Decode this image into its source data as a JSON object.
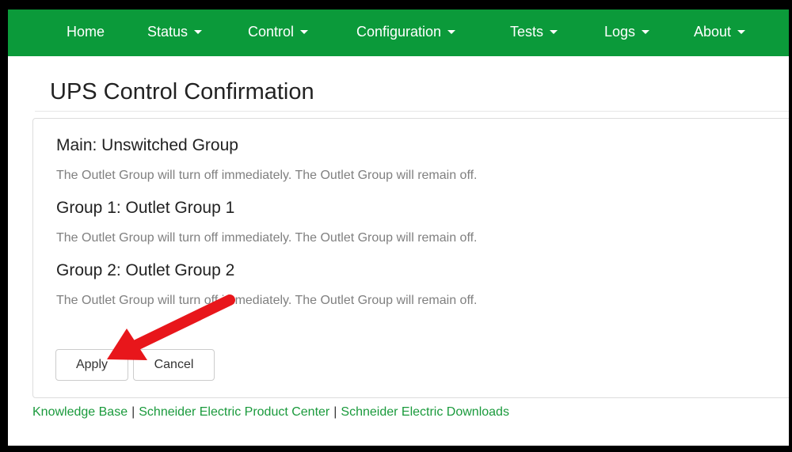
{
  "nav": {
    "items": [
      {
        "label": "Home",
        "dropdown": false
      },
      {
        "label": "Status",
        "dropdown": true
      },
      {
        "label": "Control",
        "dropdown": true
      },
      {
        "label": "Configuration",
        "dropdown": true
      },
      {
        "label": "Tests",
        "dropdown": true
      },
      {
        "label": "Logs",
        "dropdown": true
      },
      {
        "label": "About",
        "dropdown": true
      }
    ]
  },
  "page": {
    "title": "UPS Control Confirmation"
  },
  "groups": [
    {
      "title": "Main: Unswitched Group",
      "description": "The Outlet Group will turn off immediately. The Outlet Group will remain off."
    },
    {
      "title": "Group 1: Outlet Group 1",
      "description": "The Outlet Group will turn off immediately. The Outlet Group will remain off."
    },
    {
      "title": "Group 2: Outlet Group 2",
      "description": "The Outlet Group will turn off immediately. The Outlet Group will remain off."
    }
  ],
  "actions": {
    "apply_label": "Apply",
    "cancel_label": "Cancel"
  },
  "footer": {
    "links": [
      "Knowledge Base",
      "Schneider Electric Product Center",
      "Schneider Electric Downloads"
    ],
    "separator": "|"
  },
  "colors": {
    "navbar": "#0b9a3a",
    "link": "#1a9a3c",
    "annotation_arrow": "#e8161b"
  },
  "annotation": {
    "icon": "red-arrow-icon"
  }
}
